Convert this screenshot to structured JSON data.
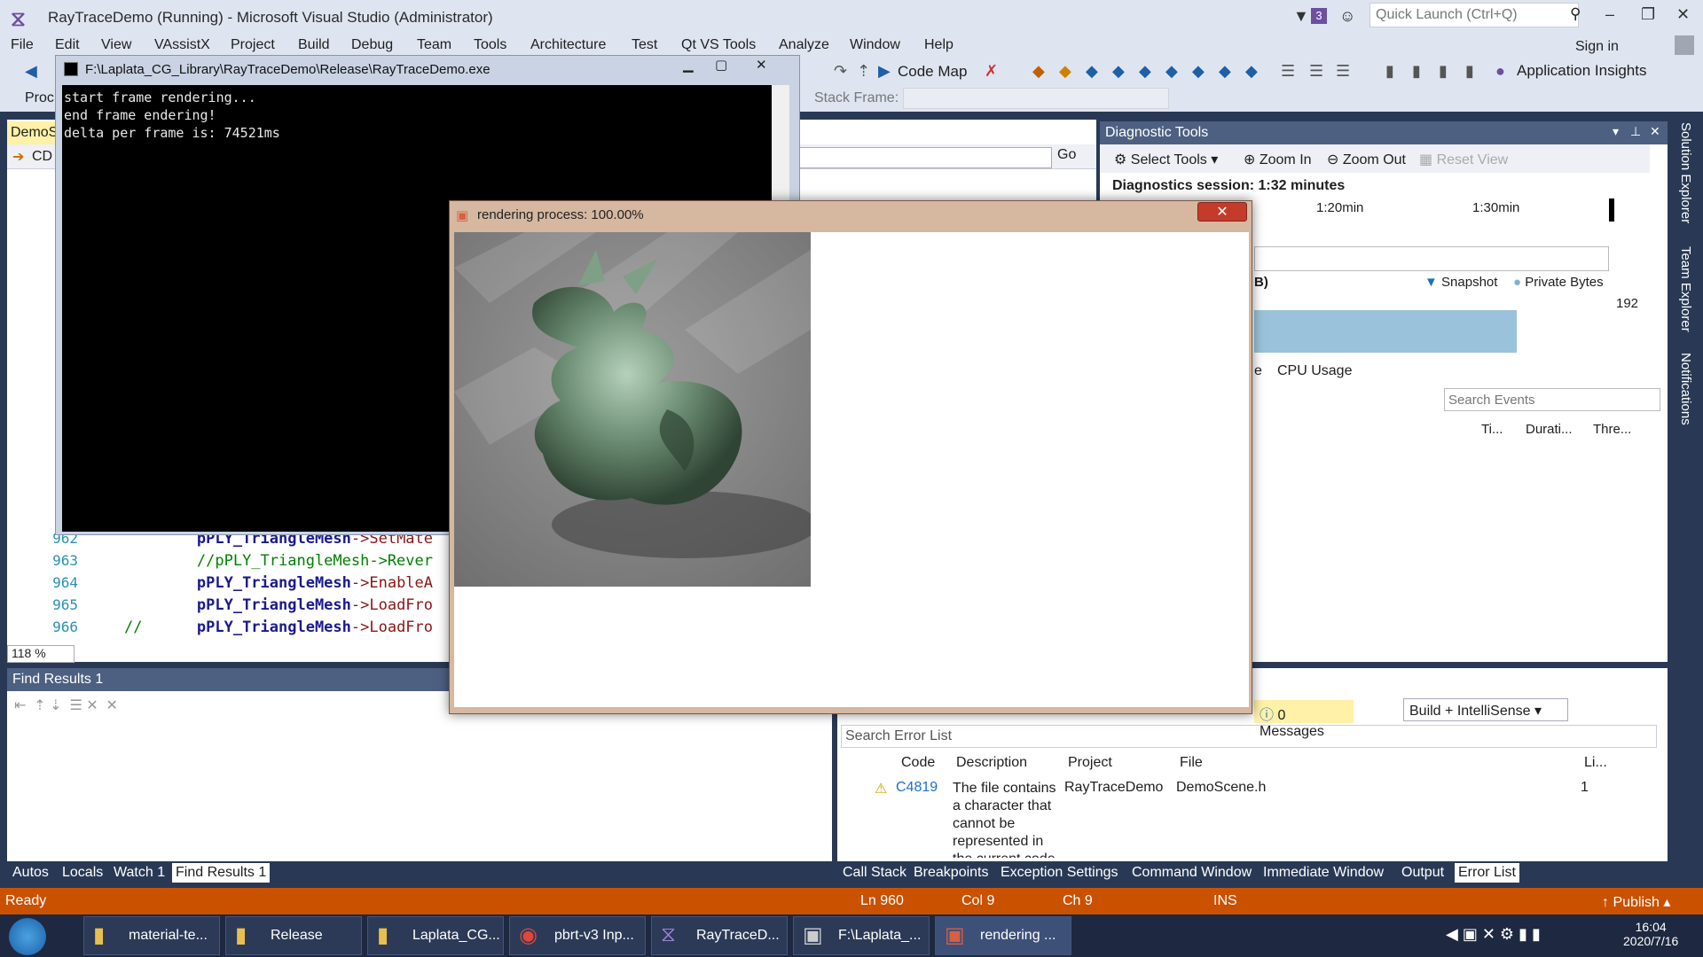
{
  "window": {
    "title": "RayTraceDemo (Running) - Microsoft Visual Studio (Administrator)",
    "notification_count": "3",
    "quick_launch_placeholder": "Quick Launch (Ctrl+Q)",
    "sign_in": "Sign in"
  },
  "menu": [
    "File",
    "Edit",
    "View",
    "VAssistX",
    "Project",
    "Build",
    "Debug",
    "Team",
    "Tools",
    "Architecture",
    "Test",
    "Qt VS Tools",
    "Analyze",
    "Window",
    "Help"
  ],
  "toolbar": {
    "code_map": "Code Map",
    "application_insights": "Application Insights",
    "stack_frame_label": "Stack Frame:",
    "proc_label": "Proc"
  },
  "editor": {
    "tab": "DemoS",
    "nav_scope": "CD",
    "go": "Go",
    "zoom": "118 %",
    "lines": [
      {
        "num": "962",
        "kw": "pPLY_TriangleMesh",
        "rest": "->SetMate",
        "prefix": "        "
      },
      {
        "num": "963",
        "kw": "",
        "rest": "//pPLY_TriangleMesh->Rever",
        "prefix": "        "
      },
      {
        "num": "964",
        "kw": "pPLY_TriangleMesh",
        "rest": "->EnableA",
        "prefix": "        "
      },
      {
        "num": "965",
        "kw": "pPLY_TriangleMesh",
        "rest": "->LoadFro",
        "prefix": "        "
      },
      {
        "num": "966",
        "kw": "pPLY_TriangleMesh",
        "rest": "->LoadFro",
        "prefix": "//      "
      }
    ]
  },
  "console": {
    "title": "F:\\Laplata_CG_Library\\RayTraceDemo\\Release\\RayTraceDemo.exe",
    "lines": [
      "start frame rendering...",
      "end frame endering!",
      "delta per frame is: 74521ms"
    ]
  },
  "render_window": {
    "title": "rendering process: 100.00%"
  },
  "diagnostic_tools": {
    "title": "Diagnostic Tools",
    "select_tools": "Select Tools",
    "zoom_in": "Zoom In",
    "zoom_out": "Zoom Out",
    "reset_view": "Reset View",
    "session": "Diagnostics session: 1:32 minutes",
    "time_1": "1:20min",
    "time_2": "1:30min",
    "mem_label_tail": "B)",
    "snapshot": "Snapshot",
    "private_bytes": "Private Bytes",
    "mem_value": "192",
    "tab_tail": "e",
    "cpu_usage": "CPU Usage",
    "search_events": "Search Events",
    "columns": [
      "Ti...",
      "Durati...",
      "Thre..."
    ]
  },
  "right_tabs": [
    "Solution Explorer",
    "Team Explorer",
    "Notifications"
  ],
  "find_results": {
    "title": "Find Results 1"
  },
  "error_list": {
    "messages": "0 Messages",
    "build_filter": "Build + IntelliSense",
    "search": "Search Error List",
    "headers": [
      "Code",
      "Description",
      "Project",
      "File",
      "Li..."
    ],
    "row": {
      "code": "C4819",
      "description": "The file contains a character that cannot be represented in the current code",
      "project": "RayTraceDemo",
      "file": "DemoScene.h",
      "line": "1"
    }
  },
  "bottom_tabs_left": [
    "Autos",
    "Locals",
    "Watch 1",
    "Find Results 1"
  ],
  "bottom_tabs_right": [
    "Call Stack",
    "Breakpoints",
    "Exception Settings",
    "Command Window",
    "Immediate Window",
    "Output",
    "Error List"
  ],
  "status": {
    "ready": "Ready",
    "ln": "Ln 960",
    "col": "Col 9",
    "ch": "Ch 9",
    "ins": "INS",
    "publish": "Publish"
  },
  "taskbar": {
    "items": [
      "material-te...",
      "Release",
      "Laplata_CG...",
      "pbrt-v3 Inp...",
      "RayTraceD...",
      "F:\\Laplata_...",
      "rendering ..."
    ],
    "time": "16:04",
    "date": "2020/7/16"
  }
}
